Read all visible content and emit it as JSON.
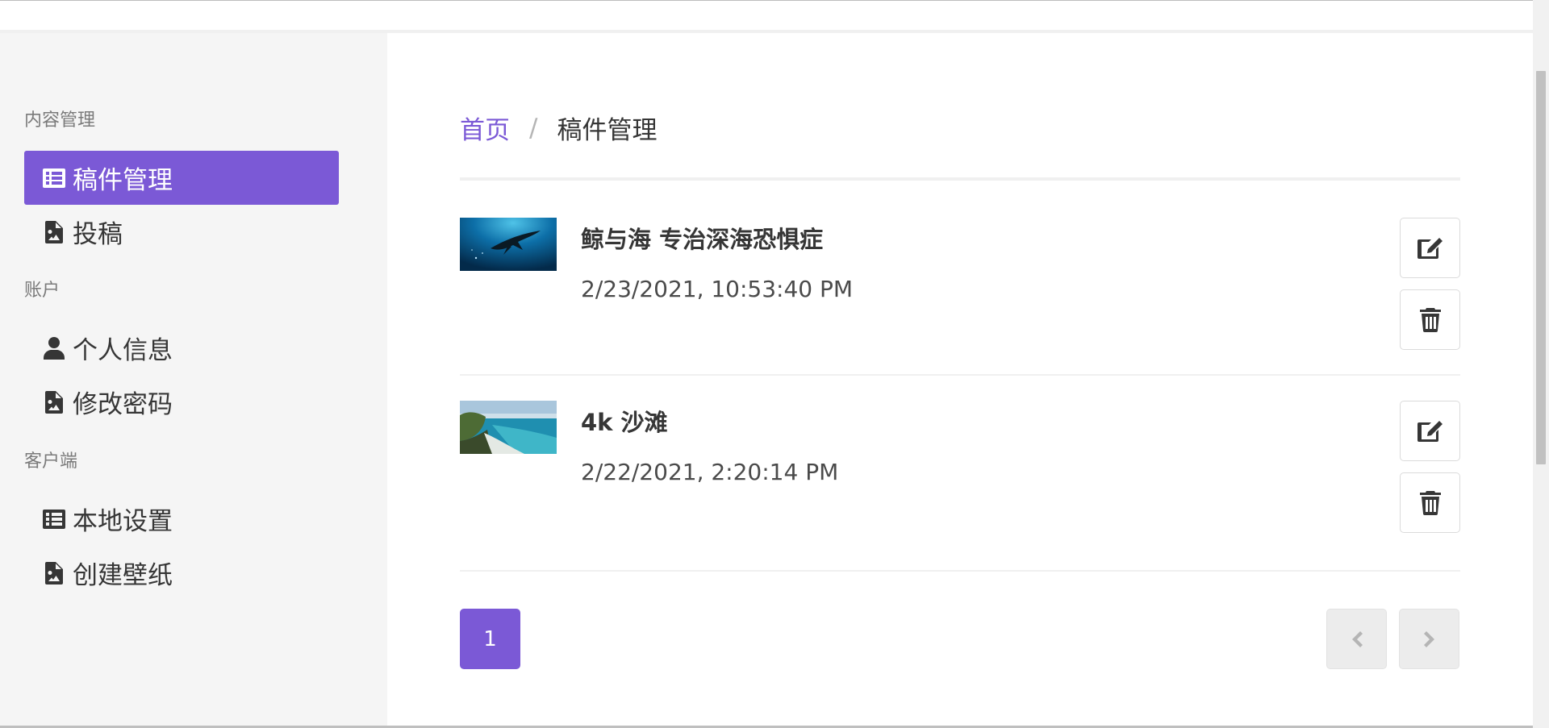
{
  "sidebar": {
    "sections": [
      {
        "label": "内容管理",
        "items": [
          {
            "label": "稿件管理",
            "icon": "list-icon",
            "active": true
          },
          {
            "label": "投稿",
            "icon": "file-image-icon"
          }
        ]
      },
      {
        "label": "账户",
        "items": [
          {
            "label": "个人信息",
            "icon": "user-icon"
          },
          {
            "label": "修改密码",
            "icon": "file-image-icon"
          }
        ]
      },
      {
        "label": "客户端",
        "items": [
          {
            "label": "本地设置",
            "icon": "list-icon"
          },
          {
            "label": "创建壁纸",
            "icon": "file-image-icon"
          }
        ]
      }
    ]
  },
  "breadcrumb": {
    "home": "首页",
    "separator": "/",
    "current": "稿件管理"
  },
  "posts": [
    {
      "title": "鲸与海 专治深海恐惧症",
      "date": "2/23/2021, 10:53:40 PM",
      "thumb": "ocean-whale"
    },
    {
      "title": "4k 沙滩",
      "date": "2/22/2021, 2:20:14 PM",
      "thumb": "beach-coast"
    }
  ],
  "pagination": {
    "current": "1"
  },
  "colors": {
    "accent": "#7b59d6",
    "sidebar_bg": "#f5f5f5"
  }
}
